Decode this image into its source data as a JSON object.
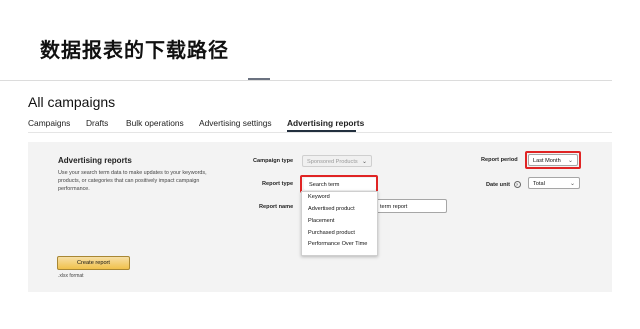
{
  "slide": {
    "title": "数据报表的下载路径"
  },
  "page": {
    "heading": "All campaigns"
  },
  "tabs": [
    {
      "label": "Campaigns"
    },
    {
      "label": "Drafts"
    },
    {
      "label": "Bulk operations"
    },
    {
      "label": "Advertising settings"
    },
    {
      "label": "Advertising reports",
      "active": true
    }
  ],
  "panel": {
    "title": "Advertising reports",
    "description": "Use your search term data to make updates to your keywords, products, or categories that can positively impact campaign performance."
  },
  "form": {
    "campaign_type_label": "Campaign type",
    "campaign_type_value": "Sponsored Products",
    "report_type_label": "Report type",
    "report_type_value": "Search term",
    "report_name_label": "Report name",
    "report_name_value_partial": "term report",
    "report_period_label": "Report period",
    "report_period_value": "Last Month",
    "date_unit_label": "Date unit",
    "date_unit_value": "Total"
  },
  "dropdown": {
    "options": [
      "Keyword",
      "Advertised product",
      "Placement",
      "Purchased product",
      "Performance Over Time"
    ]
  },
  "actions": {
    "create_report_label": "Create report",
    "format_note": ".xlsx format"
  },
  "colors": {
    "highlight": "#e02424",
    "button": "#f0c14b",
    "panel_bg": "#f3f3f3"
  },
  "icons": {
    "chevron": "chevron-down-icon",
    "info": "info-icon"
  }
}
